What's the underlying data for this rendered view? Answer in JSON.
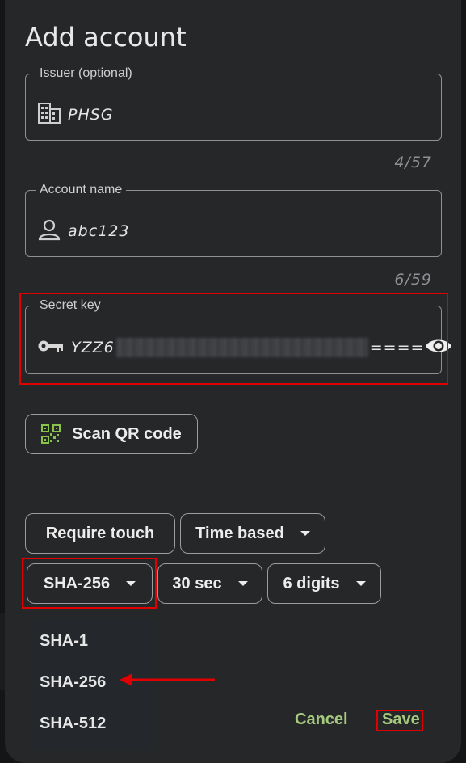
{
  "dialog": {
    "title": "Add account"
  },
  "issuer": {
    "label": "Issuer (optional)",
    "value": "PHSG",
    "counter": "4/57",
    "icon": "building-icon"
  },
  "account": {
    "label": "Account name",
    "value": "abc123",
    "counter": "6/59",
    "icon": "person-icon"
  },
  "secret": {
    "label": "Secret key",
    "prefix": "YZZ6",
    "suffix": "====",
    "icon": "key-icon",
    "toggle_icon": "eye-icon"
  },
  "scan": {
    "label": "Scan QR code",
    "icon": "qr-code-icon"
  },
  "options": {
    "require_touch": "Require touch",
    "type": "Time based",
    "algorithm": "SHA-256",
    "period": "30 sec",
    "digits": "6 digits"
  },
  "algorithm_menu": {
    "items": [
      "SHA-1",
      "SHA-256",
      "SHA-512"
    ]
  },
  "actions": {
    "cancel": "Cancel",
    "save": "Save"
  },
  "colors": {
    "accent": "#a5c97e",
    "highlight": "#e00000",
    "qr_green": "#8bc34a"
  }
}
